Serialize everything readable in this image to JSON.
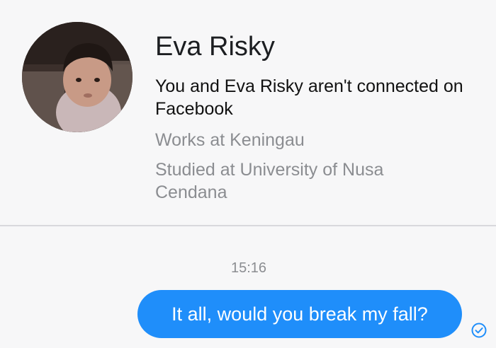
{
  "profile": {
    "name": "Eva Risky",
    "connection_text": "You and Eva Risky aren't connected on Facebook",
    "work": "Works at Keningau",
    "education": "Studied at University of Nusa Cendana",
    "avatar_icon": "profile-photo"
  },
  "conversation": {
    "timestamp": "15:16",
    "messages": [
      {
        "text": "It all, would you break my fall?",
        "sender": "self",
        "status_icon": "sent-check-icon"
      }
    ]
  },
  "colors": {
    "bubble": "#1f8efa",
    "background": "#f7f7f8",
    "secondary_text": "#8b8d91"
  }
}
